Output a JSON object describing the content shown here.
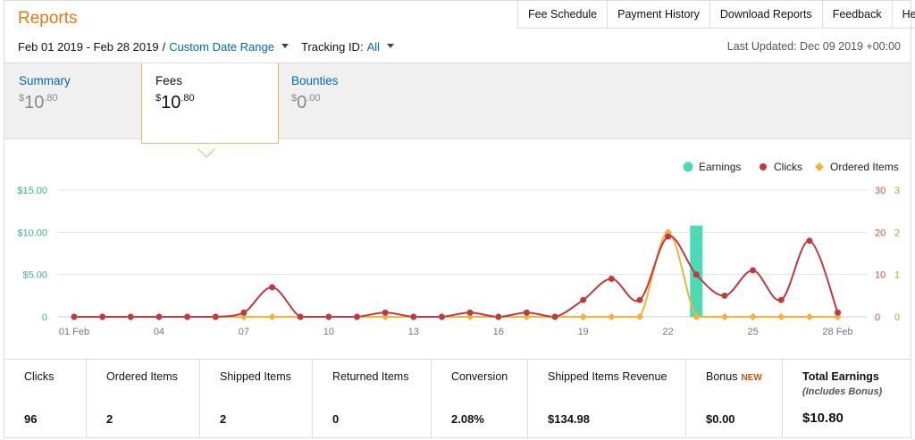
{
  "header": {
    "title": "Reports"
  },
  "topnav": [
    "Fee Schedule",
    "Payment History",
    "Download Reports",
    "Feedback",
    "Help"
  ],
  "filters": {
    "date_range": "Feb 01 2019 - Feb 28 2019",
    "separator": "/",
    "custom_range_label": "Custom Date Range",
    "tracking_label": "Tracking ID:",
    "tracking_value": "All"
  },
  "last_updated": "Last Updated: Dec 09 2019 +00:00",
  "summary_tabs": [
    {
      "label": "Summary",
      "currency": "$",
      "whole": "10",
      "cents": ".80",
      "active": false
    },
    {
      "label": "Fees",
      "currency": "$",
      "whole": "10",
      "cents": ".80",
      "active": true
    },
    {
      "label": "Bounties",
      "currency": "$",
      "whole": "0",
      "cents": ".00",
      "active": false
    }
  ],
  "chart_data": {
    "type": "line",
    "legend": [
      "Earnings",
      "Clicks",
      "Ordered Items"
    ],
    "legend_position": "top-right",
    "colors": {
      "earnings": "#4dd9b4",
      "clicks": "#c1393e",
      "ordered_items": "#f0b43c"
    },
    "x_ticks": [
      "01 Feb",
      "04",
      "07",
      "10",
      "13",
      "16",
      "19",
      "22",
      "25",
      "28 Feb"
    ],
    "x_days": [
      1,
      4,
      7,
      10,
      13,
      16,
      19,
      22,
      25,
      28
    ],
    "y_left_ticks": [
      "$15.00",
      "$10.00",
      "$5.00",
      "0"
    ],
    "y_left_range": [
      0,
      15
    ],
    "y_right1_ticks": [
      "30",
      "20",
      "10",
      "0"
    ],
    "y_right1_range": [
      0,
      30
    ],
    "y_right2_ticks": [
      "3",
      "2",
      "1",
      "0"
    ],
    "y_right2_range": [
      0,
      3
    ],
    "grid": true,
    "series": [
      {
        "name": "Earnings",
        "type": "bar",
        "axis": "left",
        "points": [
          [
            23,
            10.8
          ]
        ]
      },
      {
        "name": "Clicks",
        "type": "line",
        "axis": "right1",
        "values": [
          0,
          0,
          0,
          0,
          0,
          0,
          1,
          7,
          0,
          0,
          0,
          1,
          0,
          0,
          1,
          0,
          1,
          0,
          4,
          9,
          4,
          19,
          10,
          5,
          11,
          4,
          18,
          1
        ]
      },
      {
        "name": "Ordered Items",
        "type": "line",
        "axis": "right2",
        "values": [
          0,
          0,
          0,
          0,
          0,
          0,
          0,
          0,
          0,
          0,
          0,
          0,
          0,
          0,
          0,
          0,
          0,
          0,
          0,
          0,
          0,
          2,
          0,
          0,
          0,
          0,
          0,
          0
        ]
      }
    ]
  },
  "metrics": [
    {
      "label": "Clicks",
      "value": "96"
    },
    {
      "label": "Ordered Items",
      "value": "2"
    },
    {
      "label": "Shipped Items",
      "value": "2"
    },
    {
      "label": "Returned Items",
      "value": "0"
    },
    {
      "label": "Conversion",
      "value": "2.08%"
    },
    {
      "label": "Shipped Items Revenue",
      "value": "$134.98"
    },
    {
      "label": "Bonus",
      "badge": "NEW",
      "value": "$0.00"
    },
    {
      "label": "Total Earnings",
      "sublabel": "(Includes Bonus)",
      "value": "$10.80"
    }
  ]
}
